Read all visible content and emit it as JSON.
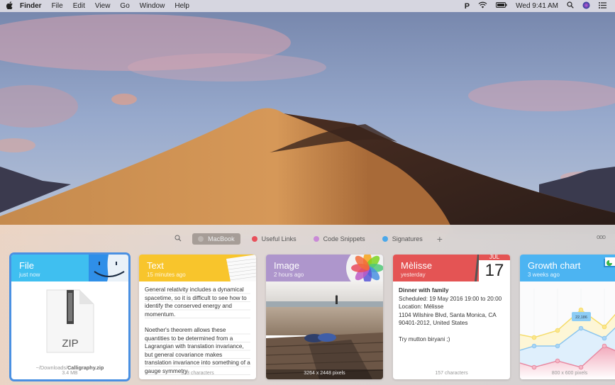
{
  "menubar": {
    "app_name": "Finder",
    "menus": [
      "File",
      "Edit",
      "View",
      "Go",
      "Window",
      "Help"
    ],
    "status": {
      "clock": "Wed 9:41 AM"
    }
  },
  "shelf": {
    "pinboards": [
      {
        "label": "MacBook",
        "color": "#bdb6b1",
        "active": true
      },
      {
        "label": "Useful Links",
        "color": "#e8505b",
        "active": false
      },
      {
        "label": "Code Snippets",
        "color": "#c98ad7",
        "active": false
      },
      {
        "label": "Signatures",
        "color": "#4aa8ea",
        "active": false
      }
    ],
    "more_label": "ooo",
    "plus_label": "+"
  },
  "cards": {
    "file": {
      "title": "File",
      "subtitle": "just now",
      "type_label": "ZIP",
      "path_prefix": "~/Downloads/",
      "filename": "Calligraphy.zip",
      "size": "3.4 MB",
      "color": "#3fbff0"
    },
    "text": {
      "title": "Text",
      "subtitle": "15 minutes ago",
      "para1": "General relativity includes a dynamical spacetime, so it is difficult to see how to identify the conserved energy and momentum.",
      "para2": "Noether's theorem allows these quantities to be determined from a Lagrangian with translation invariance, but general covariance makes translation invariance into something of a gauge symmetry.",
      "footer": "323 characters",
      "color": "#f8c52c"
    },
    "image": {
      "title": "Image",
      "subtitle": "2 hours ago",
      "footer": "3264 x 2448 pixels",
      "color": "#ae96cc"
    },
    "event": {
      "title": "Mèlisse",
      "subtitle": "yesterday",
      "event_title": "Dinner with family",
      "scheduled": "Scheduled: 19 May 2016 19:00 to 20:00",
      "location": "Location: Mélisse",
      "address": "1104 Wilshire Blvd, Santa Monica, CA 90401-2012, United States",
      "note": "Try mutton biryani ;)",
      "footer": "157 characters",
      "cal_month": "JUL",
      "cal_day": "17",
      "color": "#e45454"
    },
    "chart": {
      "title": "Growth chart",
      "subtitle": "3 weeks ago",
      "tooltip": "22,186",
      "footer": "800 x 600 pixels",
      "color": "#4cb4f2"
    }
  }
}
